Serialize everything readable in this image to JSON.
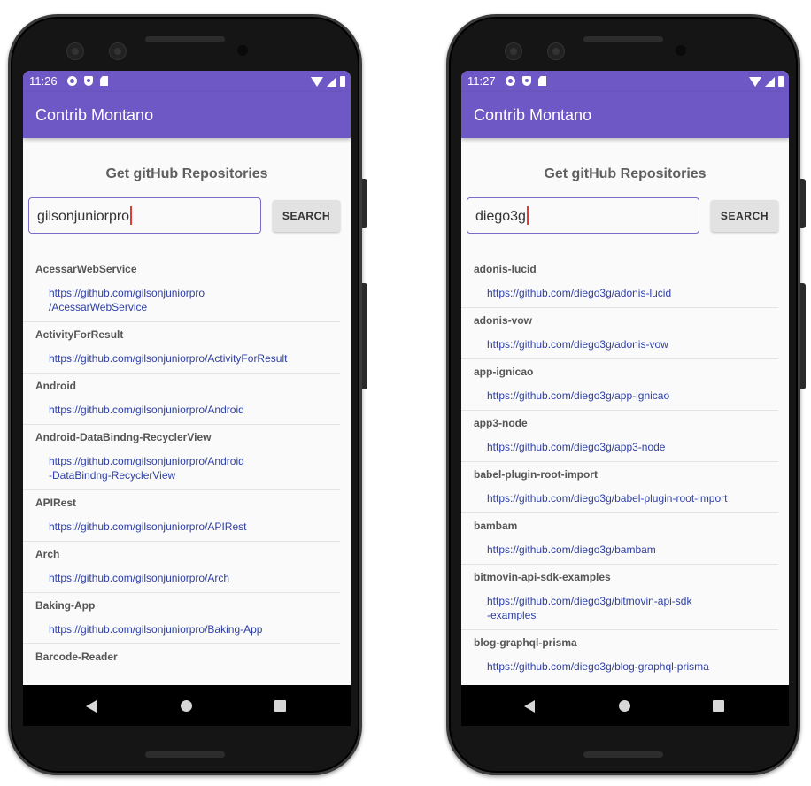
{
  "phones": [
    {
      "status_time": "11:26",
      "app_title": "Contrib Montano",
      "heading": "Get gitHub Repositories",
      "search_value": "gilsonjuniorpro",
      "search_button": "SEARCH",
      "repos": [
        {
          "name": "AcessarWebService",
          "url": "https://github.com/gilsonjuniorpro\n/AcessarWebService"
        },
        {
          "name": "ActivityForResult",
          "url": "https://github.com/gilsonjuniorpro/ActivityForResult"
        },
        {
          "name": "Android",
          "url": "https://github.com/gilsonjuniorpro/Android"
        },
        {
          "name": "Android-DataBindng-RecyclerView",
          "url": "https://github.com/gilsonjuniorpro/Android\n-DataBindng-RecyclerView"
        },
        {
          "name": "APIRest",
          "url": "https://github.com/gilsonjuniorpro/APIRest"
        },
        {
          "name": "Arch",
          "url": "https://github.com/gilsonjuniorpro/Arch"
        },
        {
          "name": "Baking-App",
          "url": "https://github.com/gilsonjuniorpro/Baking-App"
        },
        {
          "name": "Barcode-Reader",
          "url": ""
        }
      ]
    },
    {
      "status_time": "11:27",
      "app_title": "Contrib Montano",
      "heading": "Get gitHub Repositories",
      "search_value": "diego3g",
      "search_button": "SEARCH",
      "repos": [
        {
          "name": "adonis-lucid",
          "url": "https://github.com/diego3g/adonis-lucid"
        },
        {
          "name": "adonis-vow",
          "url": "https://github.com/diego3g/adonis-vow"
        },
        {
          "name": "app-ignicao",
          "url": "https://github.com/diego3g/app-ignicao"
        },
        {
          "name": "app3-node",
          "url": "https://github.com/diego3g/app3-node"
        },
        {
          "name": "babel-plugin-root-import",
          "url": "https://github.com/diego3g/babel-plugin-root-import"
        },
        {
          "name": "bambam",
          "url": "https://github.com/diego3g/bambam"
        },
        {
          "name": "bitmovin-api-sdk-examples",
          "url": "https://github.com/diego3g/bitmovin-api-sdk\n-examples"
        },
        {
          "name": "blog-graphql-prisma",
          "url": "https://github.com/diego3g/blog-graphql-prisma"
        }
      ]
    }
  ],
  "colors": {
    "primary": "#6e58c5",
    "link": "#2f40a6",
    "caret": "#e53935"
  },
  "icons": [
    "gear-icon",
    "shield-icon",
    "sd-card-icon",
    "wifi-icon",
    "signal-icon",
    "battery-icon",
    "back-icon",
    "home-icon",
    "recents-icon"
  ]
}
